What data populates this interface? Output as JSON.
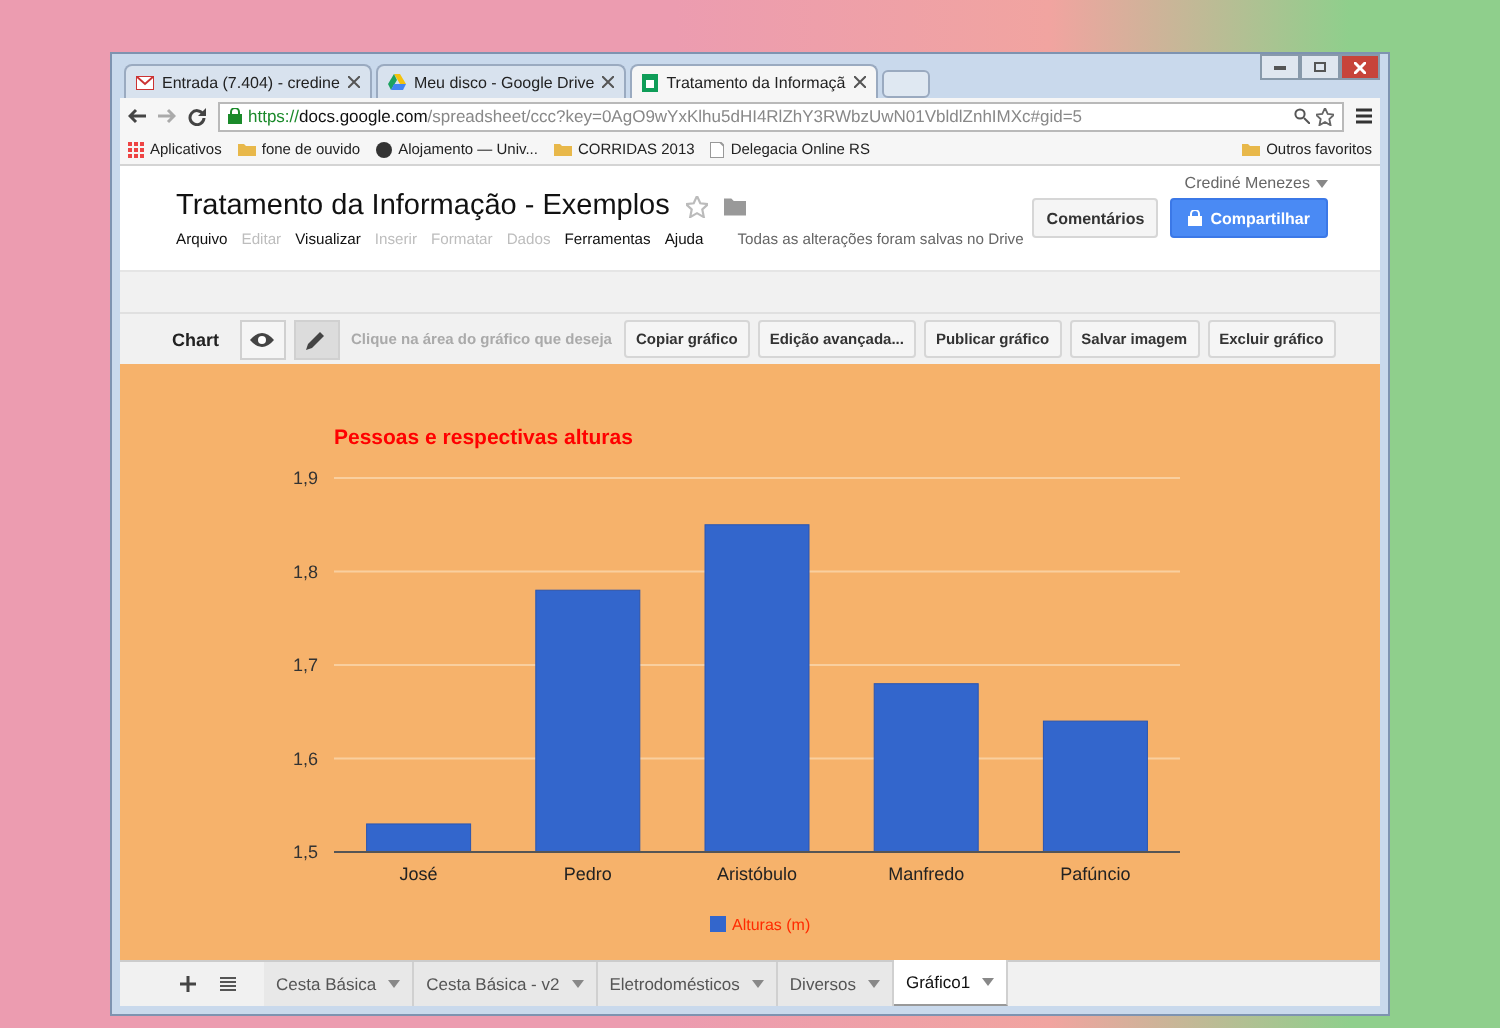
{
  "browser": {
    "tabs": [
      {
        "kind": "mail",
        "label": "Entrada (7.404) - credine",
        "selected": false
      },
      {
        "kind": "drive",
        "label": "Meu disco - Google Drive",
        "selected": false
      },
      {
        "kind": "sheet",
        "label": "Tratamento da Informaçã",
        "selected": true
      }
    ],
    "address": {
      "secure": "https://",
      "host": "docs.google.com",
      "path": "/spreadsheet/ccc?key=0AgO9wYxKlhu5dHI4RlZhY3RWbzUwN01VbldlZnhIMXc#gid=5"
    },
    "bookmarks": [
      {
        "kind": "apps",
        "label": "Aplicativos"
      },
      {
        "kind": "folder",
        "label": "fone de ouvido"
      },
      {
        "kind": "site",
        "label": "Alojamento — Univ..."
      },
      {
        "kind": "folder",
        "label": "CORRIDAS 2013"
      },
      {
        "kind": "page",
        "label": "Delegacia Online RS"
      }
    ],
    "other_bookmarks": "Outros favoritos"
  },
  "document": {
    "title": "Tratamento da Informação - Exemplos",
    "user": "Crediné Menezes",
    "comments_button": "Comentários",
    "share_button": "Compartilhar",
    "menu": [
      {
        "label": "Arquivo",
        "disabled": false
      },
      {
        "label": "Editar",
        "disabled": true
      },
      {
        "label": "Visualizar",
        "disabled": false
      },
      {
        "label": "Inserir",
        "disabled": true
      },
      {
        "label": "Formatar",
        "disabled": true
      },
      {
        "label": "Dados",
        "disabled": true
      },
      {
        "label": "Ferramentas",
        "disabled": false
      },
      {
        "label": "Ajuda",
        "disabled": false
      }
    ],
    "save_status": "Todas as alterações foram salvas no Drive"
  },
  "chart_toolbar": {
    "label": "Chart",
    "modes": [
      {
        "kind": "view",
        "selected": false
      },
      {
        "kind": "edit",
        "selected": true
      }
    ],
    "hint": "Clique na área do gráfico que deseja",
    "buttons": [
      "Copiar gráfico",
      "Edição avançada...",
      "Publicar gráfico",
      "Salvar imagem",
      "Excluir gráfico"
    ]
  },
  "chart": {
    "chart_data": {
      "type": "bar",
      "title": "Pessoas e respectivas alturas",
      "categories": [
        "José",
        "Pedro",
        "Aristóbulo",
        "Manfredo",
        "Pafúncio"
      ],
      "series": [
        {
          "name": "Alturas (m)",
          "color": "#3366cc",
          "values": [
            1.53,
            1.78,
            1.85,
            1.68,
            1.64
          ]
        }
      ],
      "ylim": [
        1.5,
        1.9
      ],
      "grid": true,
      "yticks": [
        {
          "value": 1.5,
          "label": "1,5"
        },
        {
          "value": 1.6,
          "label": "1,6"
        },
        {
          "value": 1.7,
          "label": "1,7"
        },
        {
          "value": 1.8,
          "label": "1,8"
        },
        {
          "value": 1.9,
          "label": "1,9"
        }
      ]
    }
  },
  "sheet_tabs": [
    {
      "label": "Cesta Básica",
      "selected": false
    },
    {
      "label": "Cesta Básica - v2",
      "selected": false
    },
    {
      "label": "Eletrodomésticos",
      "selected": false
    },
    {
      "label": "Diversos",
      "selected": false
    },
    {
      "label": "Gráfico1",
      "selected": true
    }
  ]
}
